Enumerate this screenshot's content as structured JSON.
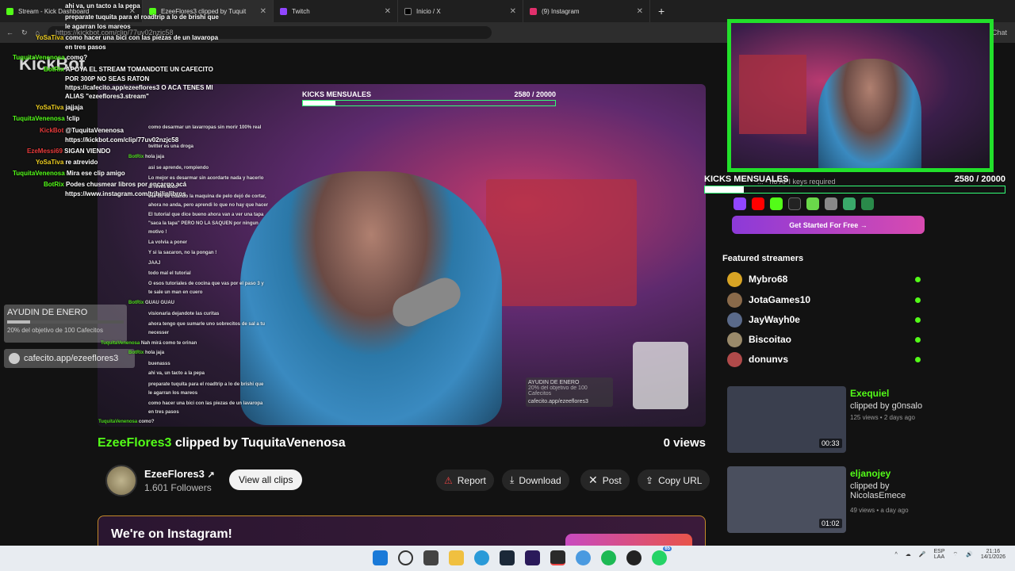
{
  "browser": {
    "tabs": [
      {
        "label": "Stream - Kick Dashboard",
        "active": false
      },
      {
        "label": "EzeeFlores3 clipped by Tuquit",
        "active": true
      },
      {
        "label": "Twitch",
        "active": false
      },
      {
        "label": "Inicio / X",
        "active": false
      },
      {
        "label": "(9) Instagram",
        "active": false
      }
    ],
    "url": "https://kickbot.com/clip/77uv02nzjc58",
    "chat_label": "Chat"
  },
  "site": {
    "logo": "KickBot"
  },
  "video": {
    "kicks_label": "KICKS MENSUALES",
    "kicks_value": "2580 / 20000",
    "kicks_progress": 0.129,
    "ayudin_title": "AYUDIN DE ENERO",
    "ayudin_sub": "20% del objetivo de 100 Cafecitos",
    "cafe_link": "cafecito.app/ezeeflores3"
  },
  "clip": {
    "streamer": "EzeeFlores3",
    "clipped_by_text": "clipped by TuquitaVenenosa",
    "views": "0 views"
  },
  "channel": {
    "name": "EzeeFlores3",
    "followers": "1.601 Followers",
    "view_all": "View all clips"
  },
  "actions": {
    "report": "Report",
    "download": "Download",
    "post": "Post",
    "copy": "Copy URL"
  },
  "instagram": {
    "title": "We're on Instagram!"
  },
  "sidebar": {
    "api_text": "... - no API keys required",
    "get_started": "Get Started For Free →",
    "featured_title": "Featured streamers",
    "streamers": [
      {
        "name": "Mybro68",
        "color": "#d8a424"
      },
      {
        "name": "JotaGames10",
        "color": "#8a6a4a"
      },
      {
        "name": "JayWayh0e",
        "color": "#5a6a8a"
      },
      {
        "name": "Biscoitao",
        "color": "#9a8a6a"
      },
      {
        "name": "donunvs",
        "color": "#b04a4a"
      }
    ],
    "clips": [
      {
        "title": "Exequiel",
        "by": "clipped by g0nsalo",
        "meta": "125 views • 2 days ago",
        "duration": "00:33"
      },
      {
        "title": "eljanojey",
        "by": "clipped by NicolasEmece",
        "meta": "49 views • a day ago",
        "duration": "01:02"
      }
    ]
  },
  "overlay": {
    "kicks_label": "KICKS MENSUALES",
    "kicks_value": "2580 / 20000",
    "kicks_progress": 0.129,
    "ayudin_title": "AYUDIN DE ENERO",
    "ayudin_sub": "20% del objetivo de 100 Cafecitos",
    "cafe_link": "cafecito.app/ezeeflores3",
    "chat": [
      {
        "user": "",
        "text": "ahi va, un tacto a la pepa"
      },
      {
        "user": "",
        "text": "preparate tuquita para el roadtrip a lo de brishi que"
      },
      {
        "user": "",
        "text": "le agarran los mareos"
      },
      {
        "user": "YoSaTiva",
        "text": "como hacer una bici con las piezas de un lavaropa"
      },
      {
        "user": "",
        "text": "en tres pasos"
      },
      {
        "user": "TuquitaVenenosa",
        "text": "como?"
      },
      {
        "user": "BotRix",
        "text": "APOYA EL STREAM TOMANDOTE UN CAFECITO"
      },
      {
        "user": "",
        "text": "POR 300P NO SEAS RATON"
      },
      {
        "user": "",
        "text": "https://cafecito.app/ezeeflores3 O ACA TENES MI"
      },
      {
        "user": "",
        "text": "ALIAS \"ezeeflores3.stream\""
      },
      {
        "user": "YoSaTiva",
        "text": "jajjaja"
      },
      {
        "user": "TuquitaVenenosa",
        "text": "!clip"
      },
      {
        "user": "KickBot",
        "text": "@TuquitaVenenosa"
      },
      {
        "user": "",
        "text": "https://kickbot.com/clip/77uv02nzjc58"
      },
      {
        "user": "EzeMessi69",
        "text": "SIGAN VIENDO"
      },
      {
        "user": "YoSaTiva",
        "text": "re atrevido"
      },
      {
        "user": "TuquitaVenenosa",
        "text": "Mira ese clip amigo"
      },
      {
        "user": "BotRix",
        "text": "Podes chusmear libros por encargo acá"
      },
      {
        "user": "",
        "text": "https://www.instagram.com/tribilinlibros"
      }
    ],
    "video_chat": [
      {
        "user": "",
        "text": "como desarmar un lavarropas sin morir 100% real"
      },
      {
        "user": "",
        "text": "twitter es una droga"
      },
      {
        "user": "BotRix",
        "text": "hola jaja"
      },
      {
        "user": "",
        "text": "asi se aprende, rompiendo"
      },
      {
        "user": "",
        "text": "Lo mejor es desarmar sin acordarte nada y hacerlo"
      },
      {
        "user": "",
        "text": "al revés todo"
      },
      {
        "user": "",
        "text": "ese lio de cuando la maquina de pelo dejó de cortar,"
      },
      {
        "user": "",
        "text": "ahora no anda, pero aprendi lo que no hay que hacer"
      },
      {
        "user": "",
        "text": "El tutorial que dice bueno ahora van a ver una tapa"
      },
      {
        "user": "",
        "text": "\"saca la tapa\" PERO NO LA SAQUEN por ningun"
      },
      {
        "user": "",
        "text": "motivo !"
      },
      {
        "user": "",
        "text": "La volvia a poner"
      },
      {
        "user": "",
        "text": "Y si la sacaron, no la pongan !"
      },
      {
        "user": "",
        "text": "JAAJ"
      },
      {
        "user": "",
        "text": "todo mal el tutorial"
      },
      {
        "user": "",
        "text": "O esos tutoriales de cocina que vas por el paso 3 y"
      },
      {
        "user": "",
        "text": "te sale un man en cuero"
      },
      {
        "user": "BotRix",
        "text": "GUAU GUAU"
      },
      {
        "user": "",
        "text": "visionaria dejandote las curitas"
      },
      {
        "user": "",
        "text": "ahora tengo que sumarle uno sobrecitos de sal a tu"
      },
      {
        "user": "",
        "text": "necesser"
      },
      {
        "user": "TuquitaVenenosa",
        "text": "Nah mirá como te orinan"
      },
      {
        "user": "BotRix",
        "text": "hola jaja"
      },
      {
        "user": "",
        "text": "buenasss"
      },
      {
        "user": "",
        "text": "ahi va, un tacto a la pepa"
      },
      {
        "user": "",
        "text": "preparate tuquita para el roadtrip a lo de brishi que"
      },
      {
        "user": "",
        "text": "le agarran los mareos"
      },
      {
        "user": "",
        "text": "como hacer una bici con las piezas de un lavaropa"
      },
      {
        "user": "",
        "text": "en tres pasos"
      },
      {
        "user": "TuquitaVenenosa",
        "text": "como?"
      }
    ]
  },
  "taskbar": {
    "lang": "ESP",
    "lang2": "LAA",
    "time": "21:16",
    "date": "14/1/2026",
    "badge": "65"
  },
  "colors": {
    "kick_green": "#53fc18",
    "cam_border": "#22e02b"
  }
}
